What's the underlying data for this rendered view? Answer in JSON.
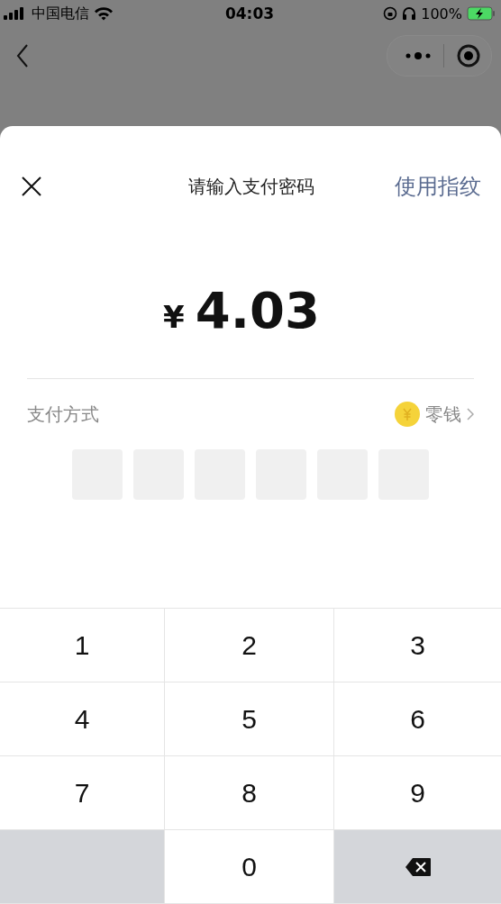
{
  "status_bar": {
    "carrier": "中国电信",
    "time": "04:03",
    "battery": "100%"
  },
  "sheet": {
    "title": "请输入支付密码",
    "fingerprint_link": "使用指纹",
    "currency": "¥",
    "amount": "4.03",
    "payment_label": "支付方式",
    "payment_method": "零钱"
  },
  "pin_slots": [
    {
      "filled": false
    },
    {
      "filled": false
    },
    {
      "filled": false
    },
    {
      "filled": false
    },
    {
      "filled": false
    },
    {
      "filled": false
    }
  ],
  "keypad": [
    {
      "kind": "digit",
      "label": "1"
    },
    {
      "kind": "digit",
      "label": "2"
    },
    {
      "kind": "digit",
      "label": "3"
    },
    {
      "kind": "digit",
      "label": "4"
    },
    {
      "kind": "digit",
      "label": "5"
    },
    {
      "kind": "digit",
      "label": "6"
    },
    {
      "kind": "digit",
      "label": "7"
    },
    {
      "kind": "digit",
      "label": "8"
    },
    {
      "kind": "digit",
      "label": "9"
    },
    {
      "kind": "blank"
    },
    {
      "kind": "digit",
      "label": "0"
    },
    {
      "kind": "backspace"
    }
  ]
}
